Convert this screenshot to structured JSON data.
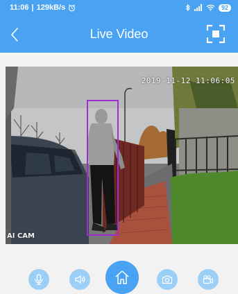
{
  "status_bar": {
    "time": "11:06",
    "net_speed": "129kB/s",
    "battery": "92"
  },
  "header": {
    "title": "Live Video"
  },
  "video": {
    "timestamp": "2019-11-12 11:06:05",
    "ai_label": "AI CAM"
  },
  "icons": {
    "back": "chevron-left-icon",
    "fullscreen": "fullscreen-icon",
    "mic": "microphone-icon",
    "speaker": "speaker-icon",
    "home": "home-icon",
    "snapshot": "camera-icon",
    "record": "video-record-icon"
  },
  "colors": {
    "accent": "#4aa3f2",
    "control_light": "#9ccff6",
    "detection_box": "#9b2dd1"
  }
}
